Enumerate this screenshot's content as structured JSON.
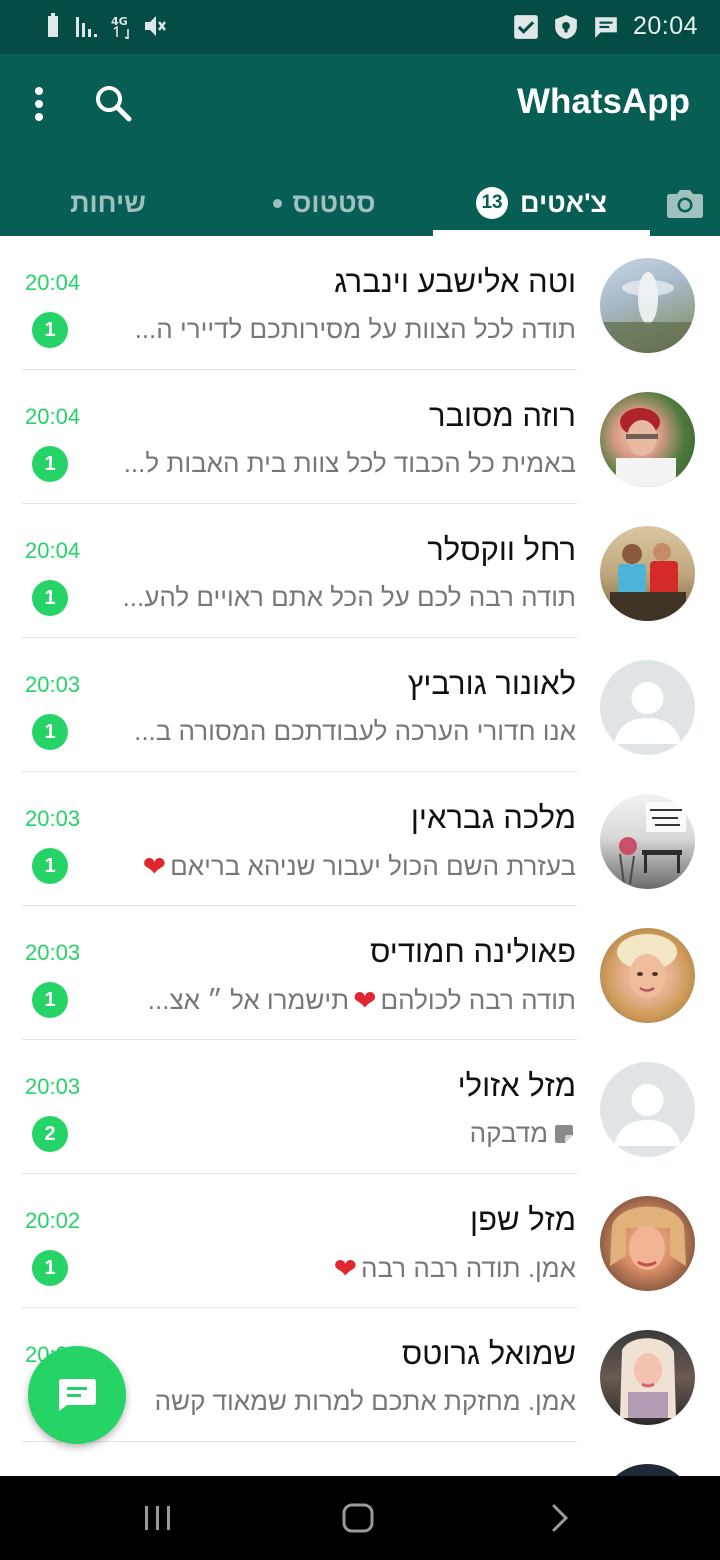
{
  "status_bar": {
    "time": "20:04",
    "left_icons": [
      "battery-icon",
      "signal-icon",
      "4g-icon",
      "mute-icon"
    ],
    "right_icons": [
      "checkbox-notification-icon",
      "shield-icon",
      "message-icon"
    ]
  },
  "header": {
    "title": "WhatsApp",
    "icons": [
      "more-vert-icon",
      "search-icon"
    ]
  },
  "tabs": [
    {
      "label": "",
      "icon": "camera-icon"
    },
    {
      "label": "צ'אטים",
      "badge": "13",
      "selected": true
    },
    {
      "label": "סטטוס",
      "has_dot": true
    },
    {
      "label": "שיחות"
    }
  ],
  "chats": [
    {
      "name": "וטה אלישבע וינברג",
      "preview": "תודה לכל הצוות על מסירותכם לדיירי ה...",
      "time": "20:04",
      "unread": "1",
      "avatar": "photo"
    },
    {
      "name": "רוזה מסובר",
      "preview": "באמית כל הכבוד לכל צוות בית האבות ל...",
      "time": "20:04",
      "unread": "1",
      "avatar": "photo"
    },
    {
      "name": "רחל ווקסלר",
      "preview": "תודה רבה לכם על הכל אתם ראויים להע...",
      "time": "20:04",
      "unread": "1",
      "avatar": "photo"
    },
    {
      "name": "לאונור גורביץ",
      "preview": "אנו חדורי הערכה לעבודתכם המסורה ב...",
      "time": "20:03",
      "unread": "1",
      "avatar": "default"
    },
    {
      "name": "מלכה גבראין",
      "preview": "בעזרת השם הכול יעבור שניהא בריאם",
      "time": "20:03",
      "unread": "1",
      "avatar": "photo",
      "trailing_heart": true
    },
    {
      "name": "פאולינה חמודיס",
      "preview_part1": "תודה רבה לכולהם",
      "preview_part2": " תישמרו אל  ״ אצ...",
      "time": "20:03",
      "unread": "1",
      "avatar": "photo"
    },
    {
      "name": "מזל אזולי",
      "preview": "מדבקה",
      "time": "20:03",
      "unread": "2",
      "avatar": "default",
      "sticker": true
    },
    {
      "name": "מזל שפן",
      "preview": "אמן. תודה רבה רבה",
      "time": "20:02",
      "unread": "1",
      "avatar": "photo",
      "trailing_heart": true
    },
    {
      "name": "שמואל גרוטס",
      "preview": "אמן. מחזקת אתכם למרות שמאוד קשה",
      "time": "20:02",
      "unread": "",
      "avatar": "photo"
    }
  ],
  "fab": {
    "icon": "new-chat-icon"
  },
  "nav": [
    "recent-apps-icon",
    "home-icon",
    "back-icon"
  ],
  "colors": {
    "header": "#075e54",
    "status_bar": "#054d44",
    "accent": "#25d366"
  }
}
